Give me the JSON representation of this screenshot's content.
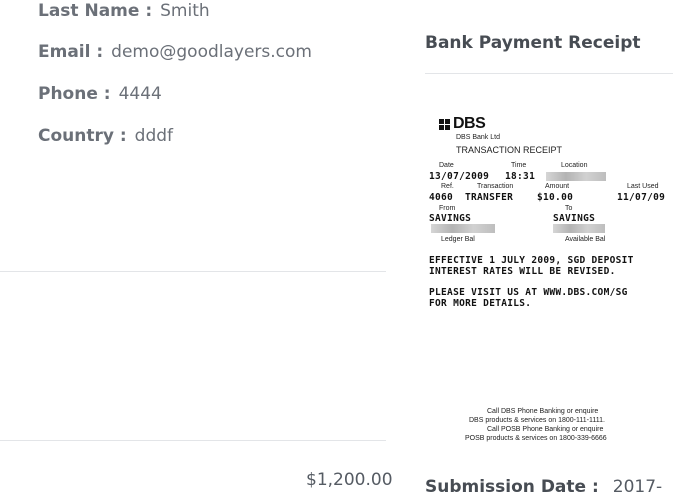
{
  "profile": {
    "last_name_label": "Last Name :",
    "last_name_value": "Smith",
    "email_label": "Email :",
    "email_value": "demo@goodlayers.com",
    "phone_label": "Phone :",
    "phone_value": "4444",
    "country_label": "Country :",
    "country_value": "dddf"
  },
  "summary": {
    "price": "$1,200.00"
  },
  "receipt_section": {
    "title": "Bank Payment Receipt"
  },
  "receipt": {
    "logo_text": "DBS",
    "bank_name": "DBS Bank Ltd",
    "heading": "TRANSACTION RECEIPT",
    "date_label": "Date",
    "time_label": "Time",
    "location_label": "Location",
    "date_value": "13/07/2009",
    "time_value": "18:31",
    "ref_label": "Ref.",
    "transaction_label": "Transaction",
    "amount_label": "Amount",
    "last_used_label": "Last Used",
    "ref_value": "4060",
    "transaction_value": "TRANSFER",
    "amount_value": "$10.00",
    "last_used_value": "11/07/09",
    "from_label": "From",
    "to_label": "To",
    "from_value": "SAVINGS",
    "to_value": "SAVINGS",
    "ledger_label": "Ledger Bal",
    "available_label": "Available Bal",
    "notice_line1": "EFFECTIVE 1 JULY 2009, SGD DEPOSIT",
    "notice_line2": "INTEREST RATES WILL BE REVISED.",
    "visit_line1": "PLEASE VISIT US AT WWW.DBS.COM/SG",
    "visit_line2": "FOR MORE DETAILS.",
    "footer_line1": "Call DBS Phone Banking or enquire",
    "footer_line2": "DBS products & services on 1800-111-1111.",
    "footer_line3": "Call POSB Phone Banking or enquire",
    "footer_line4": "POSB products & services on 1800-339-6666"
  },
  "submission": {
    "label": "Submission Date :",
    "value": "2017-"
  }
}
